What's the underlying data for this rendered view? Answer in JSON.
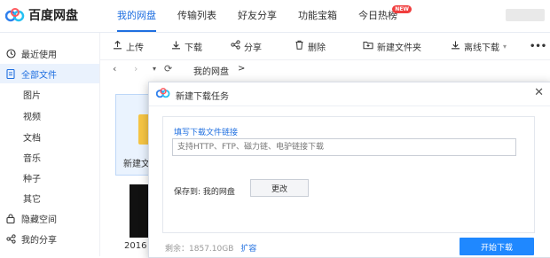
{
  "app": {
    "logo_text": "百度网盘"
  },
  "nav": [
    {
      "label": "我的网盘",
      "active": true
    },
    {
      "label": "传输列表"
    },
    {
      "label": "好友分享"
    },
    {
      "label": "功能宝箱"
    },
    {
      "label": "今日热榜",
      "badge": "NEW"
    }
  ],
  "sidebar": {
    "items": [
      {
        "label": "最近使用",
        "icon": "clock-icon"
      },
      {
        "label": "全部文件",
        "icon": "file-icon",
        "active": true
      },
      {
        "label": "图片"
      },
      {
        "label": "视频"
      },
      {
        "label": "文档"
      },
      {
        "label": "音乐"
      },
      {
        "label": "种子"
      },
      {
        "label": "其它"
      },
      {
        "label": "隐藏空间",
        "icon": "lock-icon"
      },
      {
        "label": "我的分享",
        "icon": "share-icon"
      }
    ]
  },
  "toolbar": {
    "upload": "上传",
    "download": "下载",
    "share": "分享",
    "delete": "删除",
    "new_folder": "新建文件夹",
    "offline_download": "离线下载",
    "more": "•••"
  },
  "breadcrumb": {
    "path": "我的网盘",
    "sep": ">"
  },
  "files": {
    "folder_name": "新建文",
    "thumb_label": "2016"
  },
  "dialog": {
    "title": "新建下载任务",
    "link_label": "填写下载文件链接",
    "link_placeholder": "支持HTTP、FTP、磁力链、电驴链接下载",
    "save_to": "保存到: 我的网盘",
    "change": "更改",
    "remaining_label": "剩余：",
    "remaining_value": "1857.10GB",
    "expand": "扩容",
    "start": "开始下载"
  },
  "colors": {
    "accent": "#1f6fe0",
    "button": "#1f88ff",
    "badge": "#f03e3e"
  }
}
